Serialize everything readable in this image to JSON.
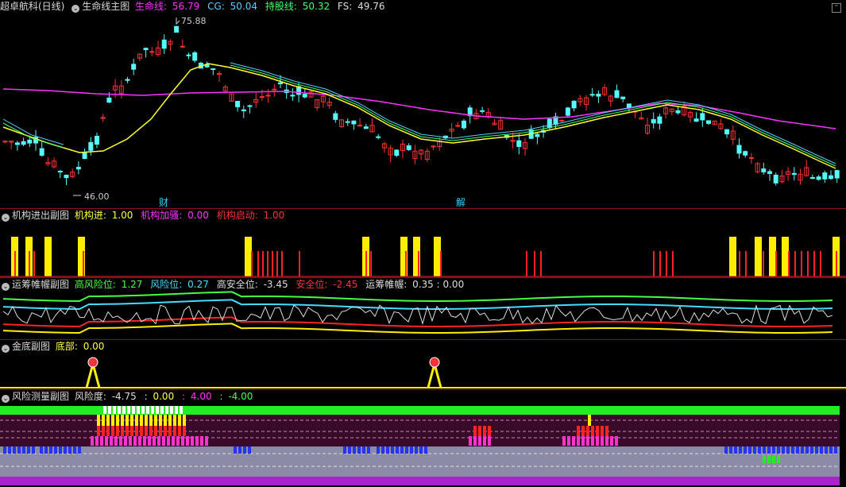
{
  "main": {
    "stock_label": "超卓航科(日线)",
    "panel_name": "生命线主图",
    "indicators": [
      {
        "label": "生命线:",
        "value": "56.79",
        "color": "#ff33ff"
      },
      {
        "label": "CG:",
        "value": "50.04",
        "color": "#55ccff"
      },
      {
        "label": "持股线:",
        "value": "50.32",
        "color": "#44ff66"
      },
      {
        "label": "FS:",
        "value": "49.76",
        "color": "#dddddd"
      }
    ],
    "high_label": "75.88",
    "low_label": "46.00",
    "marks": [
      "财",
      "解"
    ]
  },
  "sub1": {
    "panel_name": "机构进出副图",
    "indicators": [
      {
        "label": "机构进:",
        "value": "1.00",
        "color": "#ffff44"
      },
      {
        "label": "机构加骚:",
        "value": "0.00",
        "color": "#ff33ff"
      },
      {
        "label": "机构启动:",
        "value": "1.00",
        "color": "#ff3333"
      }
    ]
  },
  "sub2": {
    "panel_name": "运筹帷幄副图",
    "indicators": [
      {
        "label": "高风险位:",
        "value": "1.27",
        "color": "#44ff44"
      },
      {
        "label": "风险位:",
        "value": "0.27",
        "color": "#44ddff"
      },
      {
        "label": "高安全位:",
        "value": "-3.45",
        "color": "#dddddd"
      },
      {
        "label": "安全位:",
        "value": "-2.45",
        "color": "#ff3333"
      },
      {
        "label": "运筹帷幄:",
        "value": "0.35 : 0.00",
        "color": "#dddddd"
      }
    ]
  },
  "sub3": {
    "panel_name": "金底副图",
    "indicators": [
      {
        "label": "底部:",
        "value": "0.00",
        "color": "#ffff44"
      }
    ]
  },
  "sub4": {
    "panel_name": "风险测量副图",
    "indicators": [
      {
        "label": "风险度:",
        "value": "-4.75",
        "color": "#dddddd"
      },
      {
        "label": ":",
        "value": "0.00",
        "color": "#ffff44"
      },
      {
        "label": ":",
        "value": "4.00",
        "color": "#ff33ff"
      },
      {
        "label": ":",
        "value": "-4.00",
        "color": "#44ff44"
      }
    ]
  },
  "colors": {
    "up": "#ff3232",
    "down": "#54fcfc",
    "life_line": "#ff33ff",
    "fs_line": "#ffff33"
  }
}
